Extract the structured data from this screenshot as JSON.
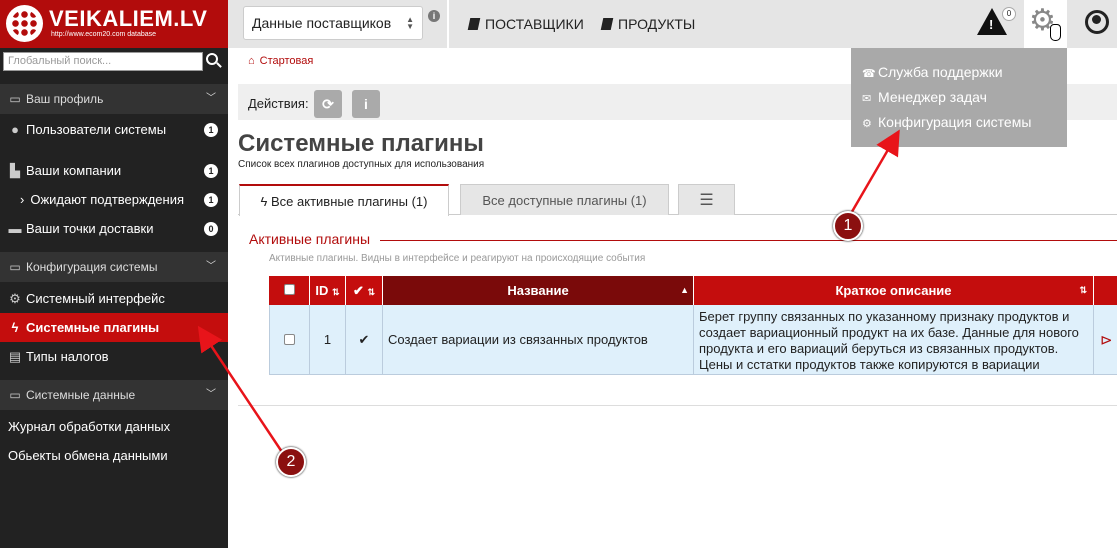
{
  "app": {
    "logo_text": "VEIKALIEM.LV",
    "logo_sub": "http://www.ecom20.com database"
  },
  "topbar": {
    "data_select": "Данные поставщиков",
    "nav": [
      "ПОСТАВЩИКИ",
      "ПРОДУКТЫ"
    ],
    "alert_count": "0"
  },
  "sidebar": {
    "search_placeholder": "Глобальный поиск...",
    "sections": [
      {
        "label": "Ваш профиль"
      },
      {
        "label": "Конфигурация системы"
      },
      {
        "label": "Системные данные"
      }
    ],
    "items": [
      {
        "label": "Пользователи системы",
        "badge": "1"
      },
      {
        "label": "Ваши компании",
        "badge": "1"
      },
      {
        "label": "Ожидают подтверждения",
        "badge": "1"
      },
      {
        "label": "Ваши точки доставки",
        "badge": "0"
      },
      {
        "label": "Системный интерфейс"
      },
      {
        "label": "Системные плагины"
      },
      {
        "label": "Типы налогов"
      },
      {
        "label": "Журнал обработки данных"
      },
      {
        "label": "Обьекты обмена данными"
      }
    ]
  },
  "breadcrumb": "Стартовая",
  "actions_label": "Действия:",
  "page": {
    "title": "Системные плагины",
    "subtitle": "Список всех плагинов доступных для использования"
  },
  "tabs": [
    {
      "label": "Все активные плагины (1)"
    },
    {
      "label": "Все доступные плагины (1)"
    }
  ],
  "section": {
    "title": "Активные плагины",
    "subtitle": "Активные плагины. Видны в интерфейсе и реагируют на происходящие события"
  },
  "table": {
    "headers": {
      "id": "ID",
      "name": "Название",
      "desc": "Краткое описание"
    },
    "rows": [
      {
        "id": "1",
        "name": "Создает вариации из связанных продуктов",
        "desc": "Берет группу связанных по указанному признаку продуктов и создает вариационный продукт на их базе. Данные для нового продукта и его вариаций беруться из связанных продуктов. Цены и сстатки продуктов также копируются в вариации"
      }
    ]
  },
  "dropdown": {
    "items": [
      "Служба поддержки",
      "Менеджер задач",
      "Конфигурация системы"
    ]
  },
  "callouts": [
    "1",
    "2"
  ]
}
